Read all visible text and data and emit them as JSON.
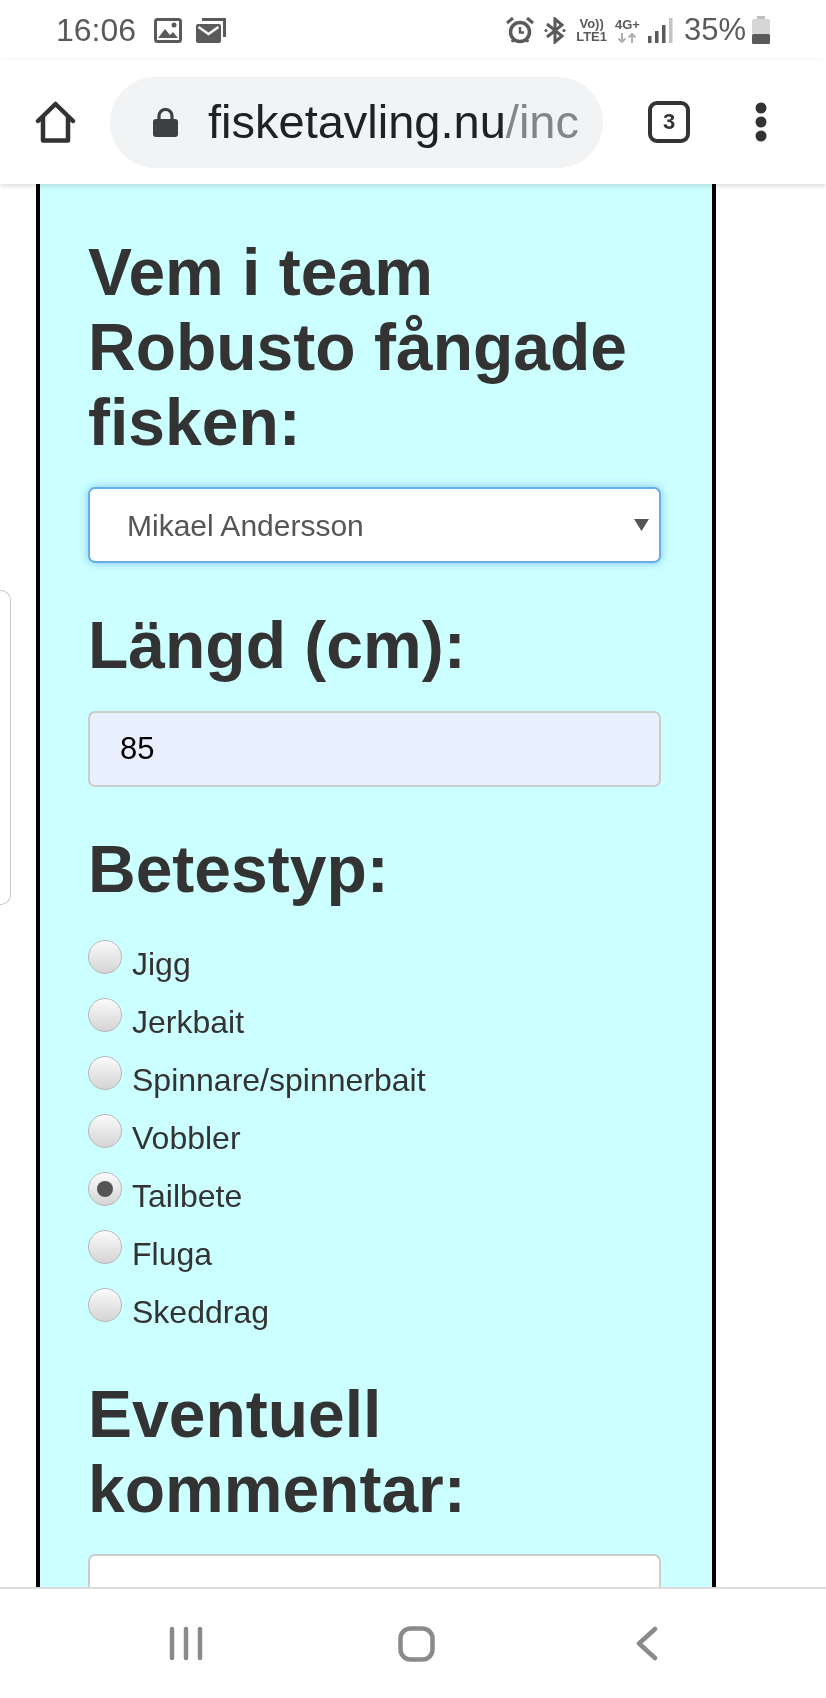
{
  "status_bar": {
    "time": "16:06",
    "volte": "Vo))",
    "lte": "LTE1",
    "network_type": "4G+",
    "battery": "35%"
  },
  "browser": {
    "url_domain": "fisketavling.nu",
    "url_path": "/inc",
    "tab_count": "3"
  },
  "form": {
    "fields": [
      {
        "kind": "select",
        "label": "Vem i team Robusto fångade fisken:",
        "value": "Mikael Andersson",
        "focused": true
      },
      {
        "kind": "number",
        "label": "Längd (cm):",
        "value": "85",
        "autofilled": true
      },
      {
        "kind": "radio",
        "label": "Betestyp:",
        "options": [
          {
            "label": "Jigg",
            "selected": false
          },
          {
            "label": "Jerkbait",
            "selected": false
          },
          {
            "label": "Spinnare/spinnerbait",
            "selected": false
          },
          {
            "label": "Vobbler",
            "selected": false
          },
          {
            "label": "Tailbete",
            "selected": true
          },
          {
            "label": "Fluga",
            "selected": false
          },
          {
            "label": "Skeddrag",
            "selected": false
          }
        ]
      },
      {
        "kind": "textarea",
        "label": "Eventuell kommentar:"
      }
    ]
  }
}
